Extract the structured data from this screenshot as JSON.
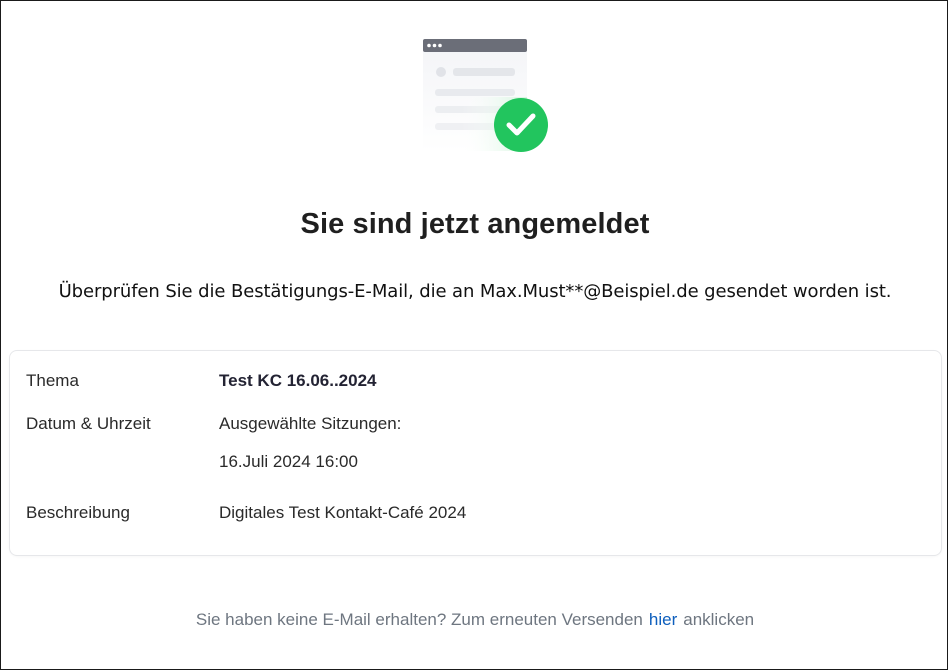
{
  "confirmation": {
    "title": "Sie sind jetzt angemeldet",
    "message": "Überprüfen Sie die Bestätigungs-E-Mail, die an Max.Must**@Beispiel.de gesendet worden ist."
  },
  "details": {
    "topic_label": "Thema",
    "topic_value": "Test KC 16.06..2024",
    "datetime_label": "Datum & Uhrzeit",
    "sessions_label": "Ausgewählte Sitzungen:",
    "session_date": "16.Juli 2024 16:00",
    "description_label": "Beschreibung",
    "description_value": "Digitales Test Kontakt-Café 2024"
  },
  "footer": {
    "text_before": "Sie haben keine E-Mail erhalten? Zum erneuten Versenden",
    "link_label": "hier",
    "text_after": "anklicken"
  },
  "colors": {
    "success": "#22c55e",
    "link": "#0e5fbd"
  },
  "icons": {
    "illustration": "email-confirmed-illustration",
    "check": "check-icon"
  }
}
